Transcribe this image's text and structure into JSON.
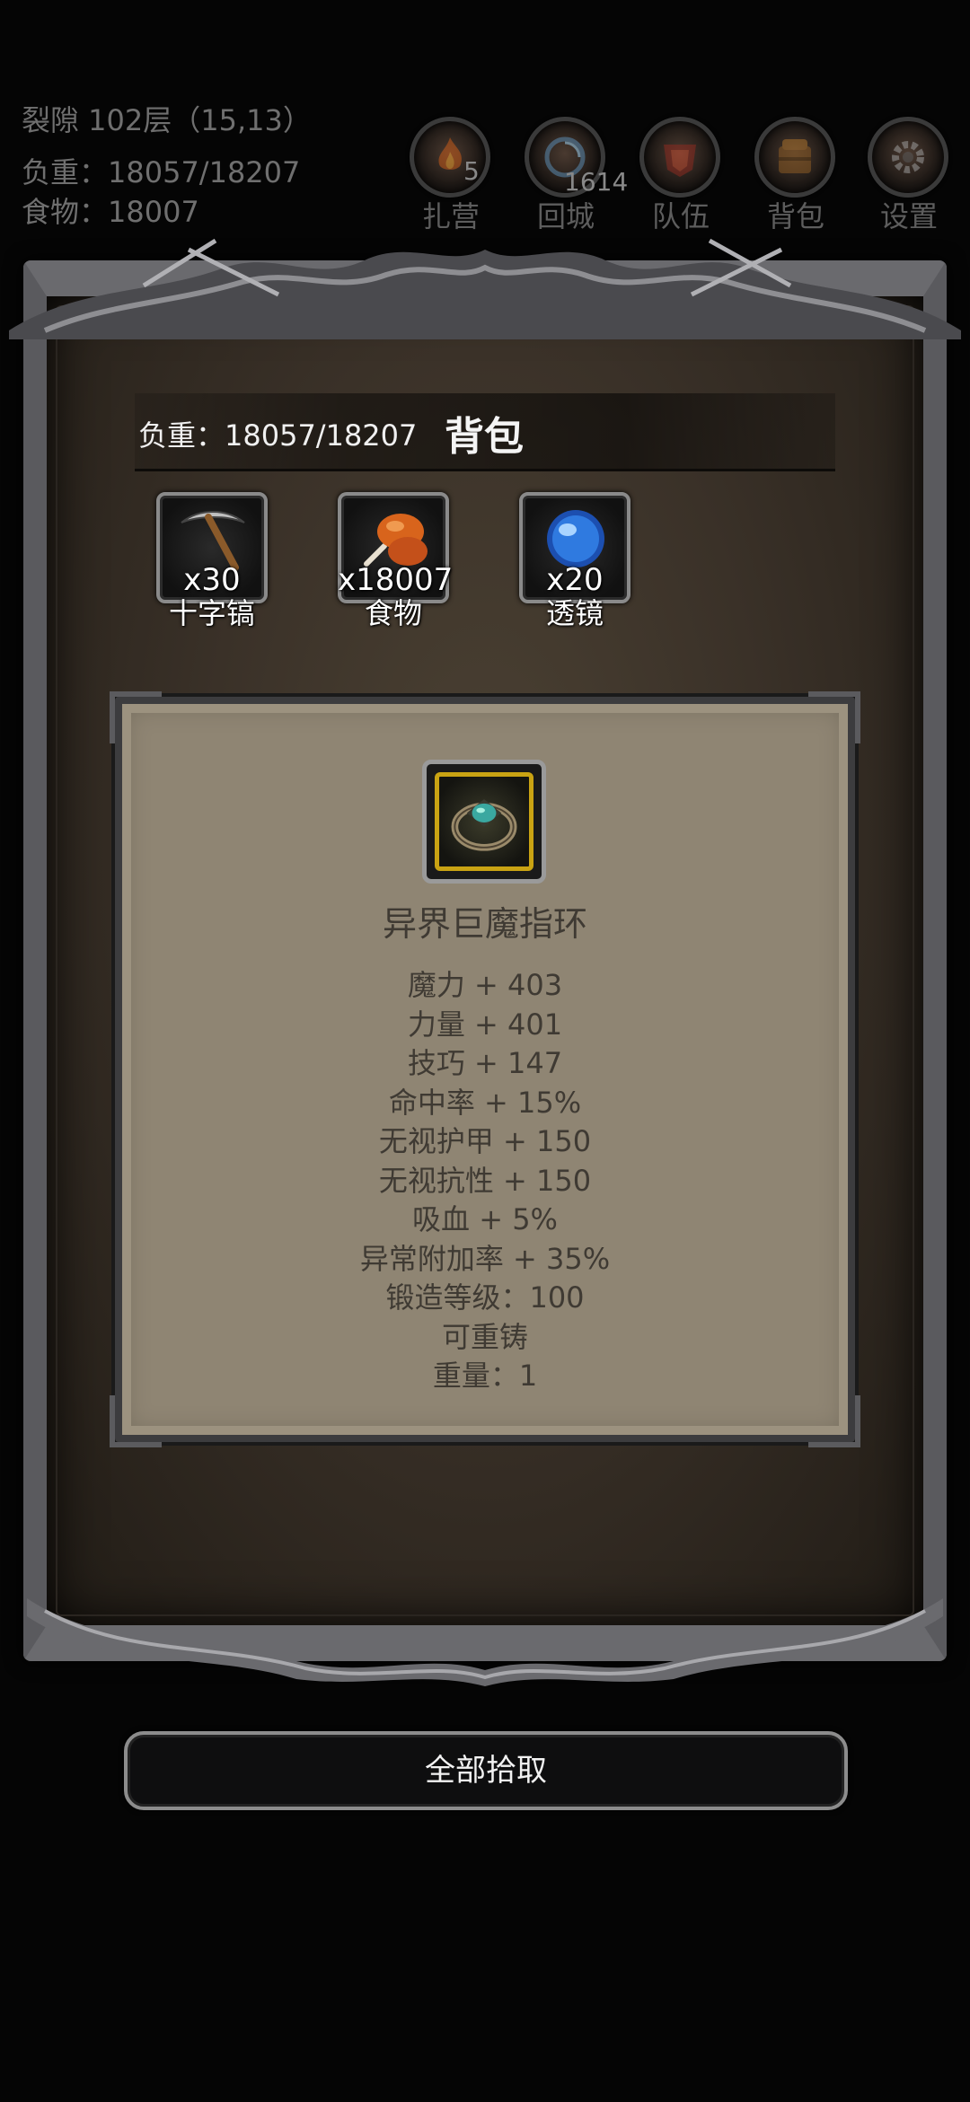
{
  "hud": {
    "location": "裂隙 102层（15,13）",
    "weight": "负重：18057/18207",
    "food": "食物：18007",
    "buttons": [
      {
        "label": "扎营",
        "badge": "5",
        "icon": "campfire-icon"
      },
      {
        "label": "回城",
        "badge": "1614",
        "icon": "portal-icon"
      },
      {
        "label": "队伍",
        "badge": "",
        "icon": "team-icon"
      },
      {
        "label": "背包",
        "badge": "",
        "icon": "backpack-icon"
      },
      {
        "label": "设置",
        "badge": "",
        "icon": "gear-icon"
      }
    ]
  },
  "bag": {
    "weight": "负重：18057/18207",
    "title": "背包",
    "items": [
      {
        "count": "x30",
        "name": "十字镐",
        "icon": "pickaxe-icon"
      },
      {
        "count": "x18007",
        "name": "食物",
        "icon": "meat-icon"
      },
      {
        "count": "x20",
        "name": "透镜",
        "icon": "lens-icon"
      }
    ]
  },
  "detail": {
    "icon": "ring-icon",
    "name": "异界巨魔指环",
    "stats": [
      "魔力 + 403",
      "力量 + 401",
      "技巧 + 147",
      "命中率 + 15%",
      "无视护甲 + 150",
      "无视抗性 + 150",
      "吸血 + 5%",
      "异常附加率 + 35%",
      "锻造等级：100",
      "可重铸",
      "重量：1"
    ]
  },
  "pickup_all": "全部拾取",
  "colors": {
    "panel": "#8f8573",
    "frame": "#5a5a5e",
    "ring_border": "#c9a313"
  }
}
